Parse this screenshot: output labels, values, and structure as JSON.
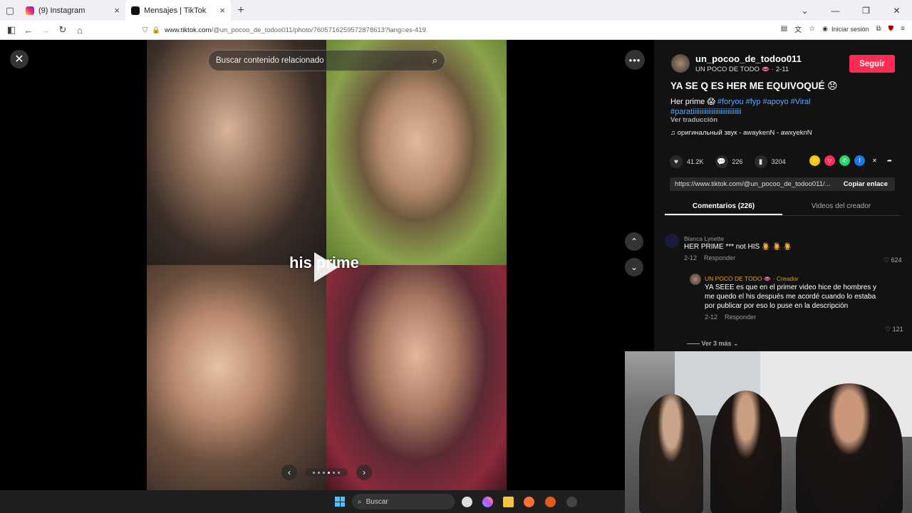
{
  "browser": {
    "tabs": [
      {
        "label": "(9) Instagram",
        "active": false
      },
      {
        "label": "Mensajes | TikTok",
        "active": true
      }
    ],
    "url_domain": "www.tiktok.com",
    "url_path": "/@un_pocoo_de_todoo011/photo/7605716259572878613?lang=es-419",
    "signin": "Iniciar sesión"
  },
  "viewer": {
    "search_placeholder": "Buscar contenido relacionado",
    "caption": "his prime"
  },
  "post": {
    "username": "un_pocoo_de_todoo011",
    "nickname": "UN POCO DE TODO 👄 · 2-11",
    "follow_label": "Seguir",
    "title": "YA SE Q ES HER ME EQUIVOQUÉ 😞",
    "desc_text": "Her prime 😱 ",
    "hashtags": [
      "#foryou",
      "#fyp",
      "#apoyo",
      "#Viral",
      "#paratiiiiiiiiiiiiiiiiiiiiiiiiiiii"
    ],
    "translate": "Ver traducción",
    "sound": "♫  оригинальный звук - awaykenN - awxyeknN",
    "likes": "41.2K",
    "comments": "226",
    "saves": "3204",
    "link": "https://www.tiktok.com/@un_pocoo_de_todoo011/...",
    "copy_label": "Copiar enlace",
    "tab_comments": "Comentarios (226)",
    "tab_creator": "Videos del creador"
  },
  "comments": [
    {
      "name": "Bianca Lynette",
      "text": "HER PRIME *** not HIS 🧛‍♀️ 🧛‍♀️ 🧛‍♀️",
      "date": "2-12",
      "reply": "Responder",
      "likes": "624"
    },
    {
      "name": "UN POCO DE TODO 👄 · Creador",
      "text": "YA SEEE es que en el primer video hice de hombres y me quedo el his después me acordé cuando lo estaba por publicar por eso lo puse en la descripción",
      "date": "2-12",
      "reply": "Responder",
      "likes": "121"
    }
  ],
  "more_replies": "Ver 3 más ⌄",
  "taskbar": {
    "search": "Buscar"
  },
  "colors": {
    "follow": "#fe2c55",
    "hashtag": "#5fa8ff",
    "panel_bg": "#121212"
  }
}
